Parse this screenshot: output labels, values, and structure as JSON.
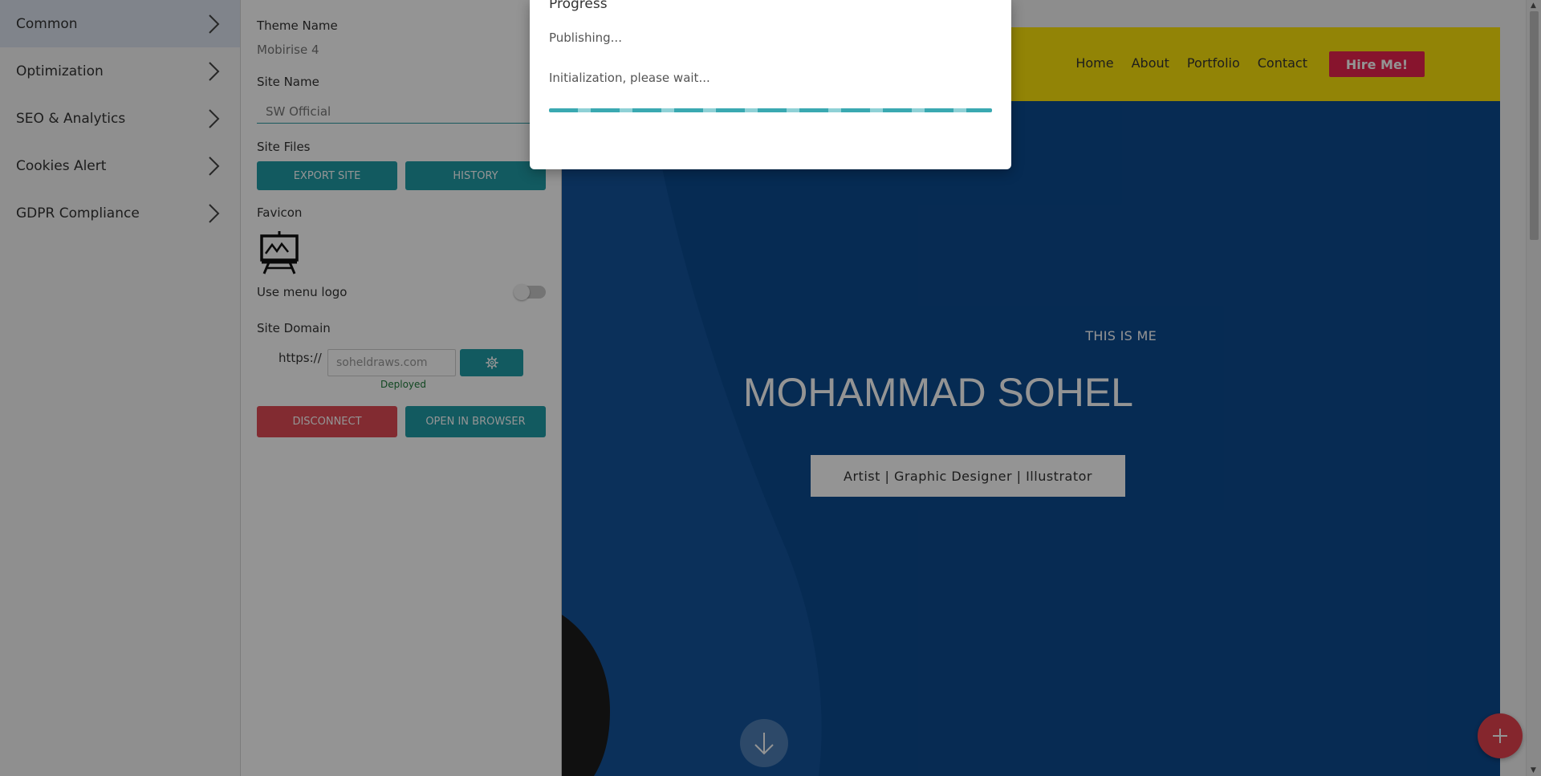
{
  "sidebar": {
    "items": [
      {
        "label": "Common"
      },
      {
        "label": "Optimization"
      },
      {
        "label": "SEO & Analytics"
      },
      {
        "label": "Cookies Alert"
      },
      {
        "label": "GDPR Compliance"
      }
    ]
  },
  "settings": {
    "theme_name_label": "Theme Name",
    "theme_name_value": "Mobirise 4",
    "site_name_label": "Site Name",
    "site_name_value": "SW Official",
    "site_files_label": "Site Files",
    "export_label": "Export Site",
    "history_label": "History",
    "favicon_label": "Favicon",
    "favicon_icon": "easel-icon",
    "menu_logo_label": "Use menu logo",
    "menu_logo_on": false,
    "site_domain_label": "Site Domain",
    "protocol": "https://",
    "domain_placeholder": "soheldraws.com",
    "domain_status": "Deployed",
    "disconnect_label": "Disconnect",
    "open_browser_label": "Open in Browser"
  },
  "preview": {
    "nav": [
      "Home",
      "About",
      "Portfolio",
      "Contact"
    ],
    "hire_label": "Hire Me!",
    "kicker": "THIS IS ME",
    "name": "MOHAMMAD SOHEL",
    "tagline": "Artist | Graphic Designer | Illustrator"
  },
  "modal": {
    "title": "Progress",
    "status": "Publishing...",
    "detail": "Initialization, please wait...",
    "progress": 1.0
  },
  "colors": {
    "accent": "#1f9ba6",
    "danger": "#e04a55",
    "header_yellow": "#fbe30b",
    "hero_blue": "#0c4a8f",
    "hire_pink": "#e8234e"
  }
}
